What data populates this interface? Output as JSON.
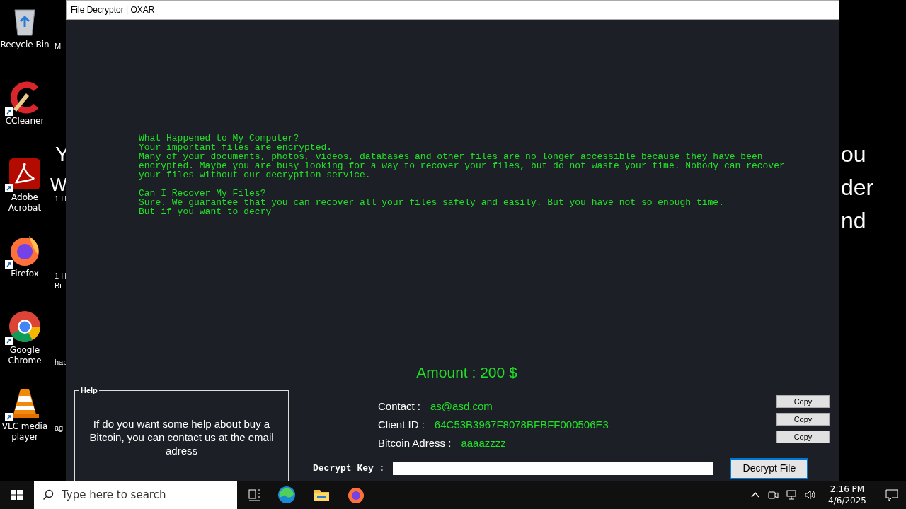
{
  "desktop": {
    "icons": [
      {
        "kind": "recycle",
        "label": "Recycle Bin"
      },
      {
        "kind": "ccleaner",
        "label": "CCleaner"
      },
      {
        "kind": "acrobat",
        "label": "Adobe Acrobat"
      },
      {
        "kind": "firefox",
        "label": "Firefox"
      },
      {
        "kind": "chrome",
        "label": "Google Chrome"
      },
      {
        "kind": "vlc",
        "label": "VLC media player"
      }
    ],
    "column_2": [
      {
        "lines": [
          "M"
        ]
      },
      {
        "lines": [
          "1 H"
        ]
      },
      {
        "lines": [
          "1 H",
          "Bi"
        ]
      },
      {
        "lines": [
          "hap"
        ]
      },
      {
        "lines": [
          "ag"
        ]
      }
    ],
    "background_text_left": [
      "Y",
      "W"
    ],
    "background_text_right": [
      "ou",
      "der",
      "nd"
    ]
  },
  "window": {
    "title": "File Decryptor | OXAR",
    "note": [
      {
        "lines": [
          "What Happened to My Computer?",
          "Your important files are encrypted.",
          "Many of your documents, photos, videos, databases and other files are no longer accessible because they have been",
          "encrypted. Maybe you are busy looking for a way to recover your files, but do not waste your time. Nobody can recover",
          "your files without our decryption service."
        ]
      },
      {
        "lines": [
          "Can I Recover My Files?",
          "Sure. We guarantee that you can recover all your files safely and easily. But you have not so enough time.",
          "But if you want to decry"
        ]
      }
    ],
    "amount": "Amount : 200 $",
    "help": {
      "title": "Help",
      "text": "If do you want some help about buy a Bitcoin, you can contact us at the email adress"
    },
    "fields": [
      {
        "label": "Contact :",
        "value": "as@asd.com",
        "button": "Copy"
      },
      {
        "label": "Client ID :",
        "value": "64C53B3967F8078BFBFF000506E3",
        "button": "Copy"
      },
      {
        "label": "Bitcoin Adress :",
        "value": "aaaazzzz",
        "button": "Copy"
      }
    ],
    "decrypt_key": {
      "label": "Decrypt Key :"
    },
    "decrypt_button": "Decrypt File"
  },
  "taskbar": {
    "search": {
      "placeholder": "Type here to search"
    },
    "time": "2:16 PM",
    "date": "4/6/2025"
  }
}
